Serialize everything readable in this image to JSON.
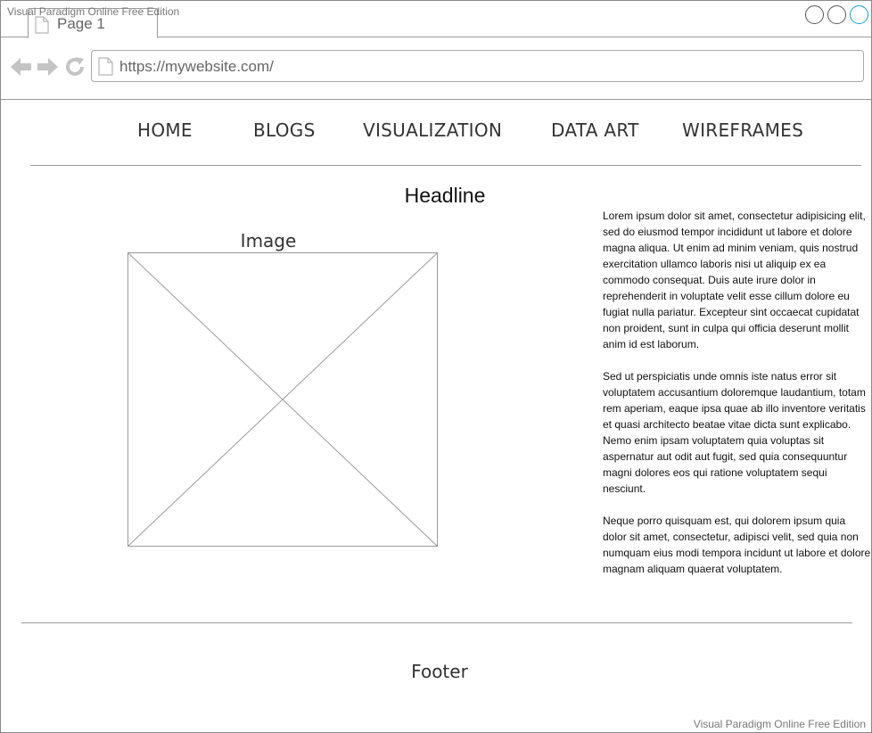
{
  "watermark": {
    "top": "Visual Paradigm Online Free Edition",
    "bottom": "Visual Paradigm Online Free Edition"
  },
  "browser": {
    "tab_label": "Page 1",
    "url": "https://mywebsite.com/"
  },
  "nav": {
    "items": [
      {
        "label": "HOME"
      },
      {
        "label": "BLOGS"
      },
      {
        "label": "VISUALIZATION"
      },
      {
        "label": "DATA ART"
      },
      {
        "label": "WIREFRAMES"
      }
    ]
  },
  "content": {
    "headline": "Headline",
    "image_label": "Image",
    "paragraphs": [
      "Lorem ipsum dolor sit amet, consectetur adipisicing elit, sed do eiusmod tempor incididunt ut labore et dolore magna aliqua. Ut enim ad minim veniam, quis nostrud exercitation ullamco laboris nisi ut aliquip ex ea commodo consequat. Duis aute irure dolor in reprehenderit in voluptate velit esse cillum dolore eu fugiat nulla pariatur. Excepteur sint occaecat cupidatat non proident, sunt in culpa qui officia deserunt mollit anim id est laborum.",
      "Sed ut perspiciatis unde omnis iste natus error sit voluptatem accusantium doloremque laudantium, totam rem aperiam, eaque ipsa quae ab illo inventore veritatis et quasi architecto beatae vitae dicta sunt explicabo. Nemo enim ipsam voluptatem quia voluptas sit aspernatur aut odit aut fugit, sed quia consequuntur magni dolores eos qui ratione voluptatem sequi nesciunt.",
      "Neque porro quisquam est, qui dolorem ipsum quia dolor sit amet, consectetur, adipisci velit, sed quia non numquam eius modi tempora incidunt ut labore et dolore magnam aliquam quaerat voluptatem."
    ]
  },
  "footer": {
    "label": "Footer"
  },
  "colors": {
    "window_active_accent": "#1e9ad6",
    "line_gray": "#9a9a9a",
    "icon_gray": "#c4c4c4"
  },
  "icons": {
    "tab": "page-icon",
    "back": "arrow-left-icon",
    "forward": "arrow-right-icon",
    "reload": "reload-icon",
    "url": "page-icon",
    "window_buttons": [
      "circle-icon",
      "circle-icon",
      "circle-icon"
    ]
  }
}
